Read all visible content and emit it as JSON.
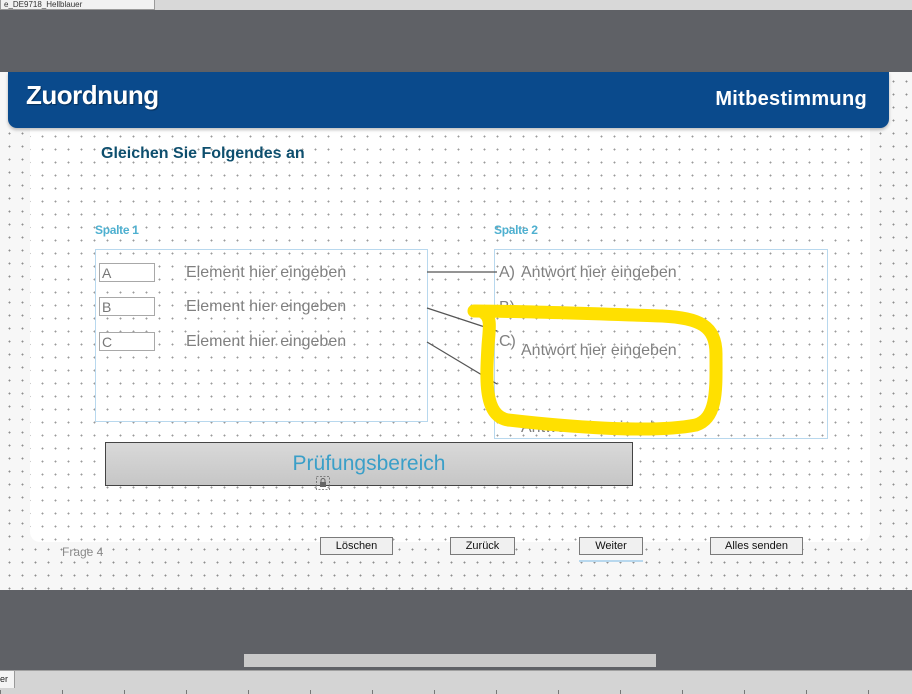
{
  "window": {
    "tab_title": "e_DE9718_Hellblauer",
    "bottom_tab": "er"
  },
  "slide": {
    "title": "Zuordnung",
    "subtitle": "Mitbestimmung",
    "instruction": "Gleichen Sie Folgendes an",
    "column1": {
      "label": "Spalte 1",
      "items": [
        {
          "code": "A",
          "text": "Element hier eingeben"
        },
        {
          "code": "B",
          "text": "Element hier eingeben"
        },
        {
          "code": "C",
          "text": "Element hier eingeben"
        }
      ]
    },
    "column2": {
      "label": "Spalte 2",
      "answers": [
        {
          "letter": "A)",
          "text": "Antwort hier eingeben"
        },
        {
          "letter": "B)",
          "text": ""
        },
        {
          "letter": "C)",
          "text": "Antwort hier eingeben"
        }
      ],
      "extra_answer": "Antwort hier eingeben"
    },
    "review_area": "Prüfungsbereich",
    "question_label": "Frage 4",
    "buttons": {
      "clear": "Löschen",
      "back": "Zurück",
      "next": "Weiter",
      "submit_all": "Alles senden"
    }
  },
  "colors": {
    "header_blue": "#0a4a8c",
    "accent_teal": "#4eb0d0",
    "highlight_yellow": "#ffe000"
  }
}
